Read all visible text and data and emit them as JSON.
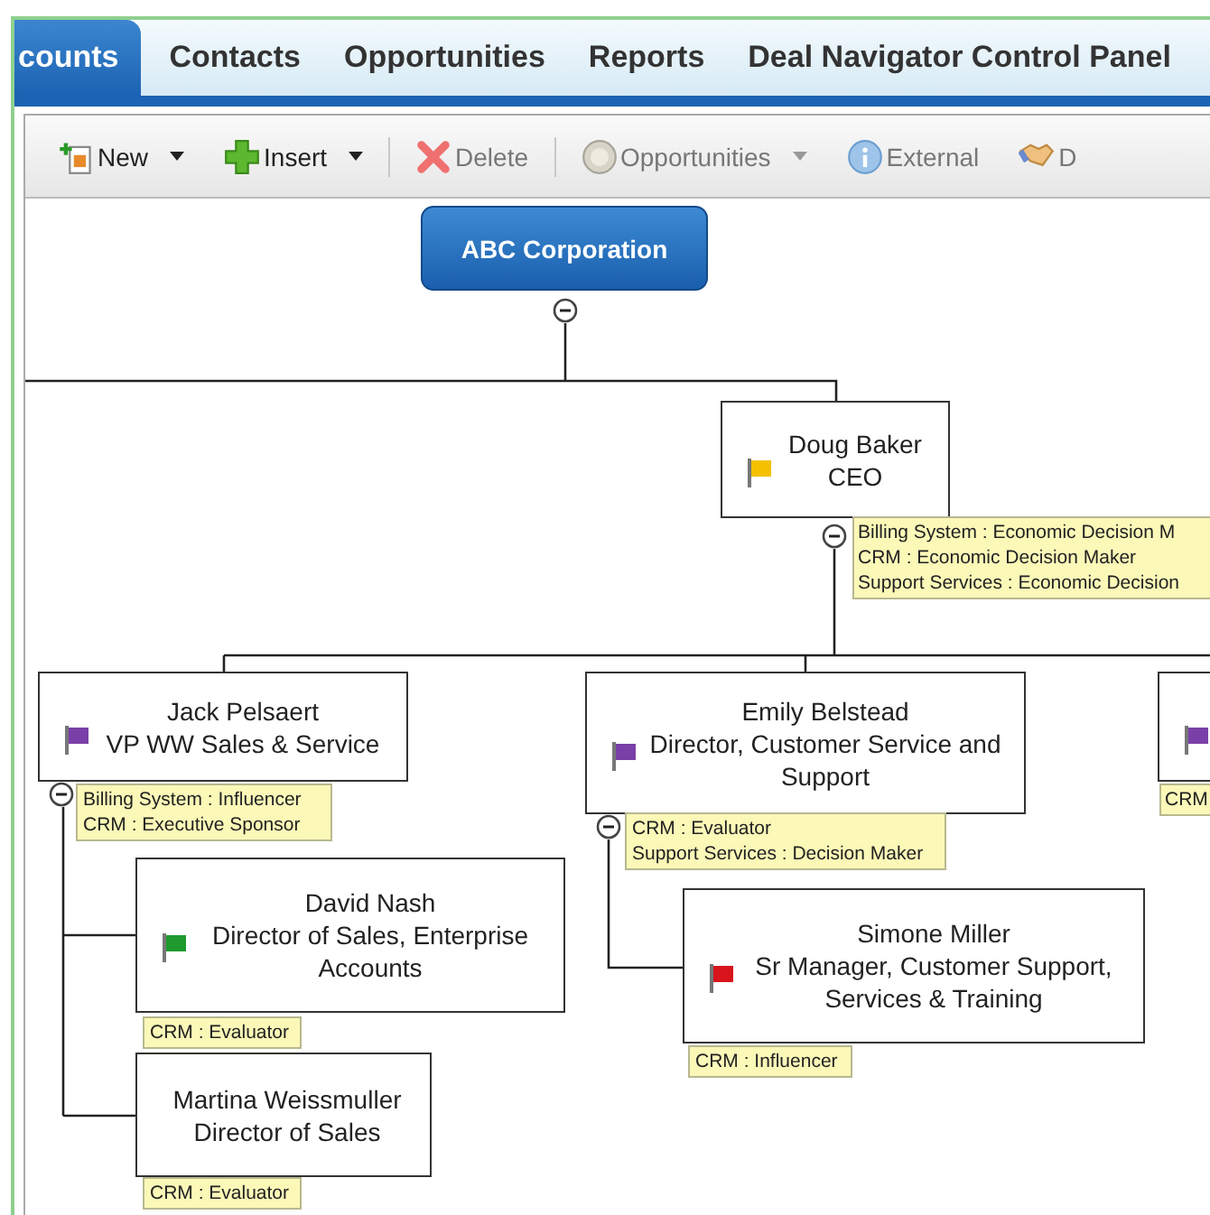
{
  "tabs": [
    {
      "label": "counts",
      "selected": true
    },
    {
      "label": "Contacts",
      "selected": false
    },
    {
      "label": "Opportunities",
      "selected": false
    },
    {
      "label": "Reports",
      "selected": false
    },
    {
      "label": "Deal Navigator Control Panel",
      "selected": false
    }
  ],
  "toolbar": [
    {
      "kind": "new",
      "label": "New",
      "dropdown": true,
      "disabled": false
    },
    {
      "kind": "insert",
      "label": "Insert",
      "dropdown": true,
      "disabled": false
    },
    {
      "kind": "delete",
      "label": "Delete",
      "dropdown": false,
      "disabled": true
    },
    {
      "kind": "opportunities",
      "label": "Opportunities",
      "dropdown": true,
      "disabled": true
    },
    {
      "kind": "external",
      "label": "External",
      "dropdown": false,
      "disabled": true
    },
    {
      "kind": "handshake",
      "label": "D",
      "dropdown": false,
      "disabled": true
    }
  ],
  "org_chart": {
    "kind": "company",
    "name": "ABC Corporation",
    "expanded": true,
    "children": [
      {
        "kind": "person",
        "name": "Doug Baker",
        "title": "CEO",
        "color": "#f5c000",
        "expanded": true,
        "roles": [
          "Billing System : Economic Decision M",
          "CRM : Economic Decision Maker",
          "Support Services : Economic Decision"
        ],
        "children": [
          {
            "kind": "person",
            "name": "Jack Pelsaert",
            "title": "VP WW Sales & Service",
            "color": "#7b3fa8",
            "expanded": true,
            "roles": [
              "Billing System : Influencer",
              "CRM : Executive Sponsor"
            ],
            "children": [
              {
                "kind": "person",
                "name": "David Nash",
                "title": "Director of  Sales, Enterprise Accounts",
                "color": "#1f9a2e",
                "roles": [
                  "CRM : Evaluator"
                ]
              },
              {
                "kind": "person",
                "name": "Martina Weissmuller",
                "title": "Director of Sales",
                "roles": [
                  "CRM : Evaluator"
                ]
              }
            ]
          },
          {
            "kind": "person",
            "name": "Emily Belstead",
            "title": "Director, Customer Service and Support",
            "color": "#7b3fa8",
            "expanded": true,
            "roles": [
              "CRM : Evaluator",
              "Support Services : Decision Maker"
            ],
            "children": [
              {
                "kind": "person",
                "name": "Simone Miller",
                "title": "Sr Manager, Customer Support, Services & Training",
                "color": "#d8141c",
                "roles": [
                  "CRM : Influencer"
                ]
              }
            ]
          },
          {
            "kind": "person",
            "color": "#7b3fa8",
            "roles": [
              "CRM"
            ]
          }
        ]
      }
    ]
  }
}
